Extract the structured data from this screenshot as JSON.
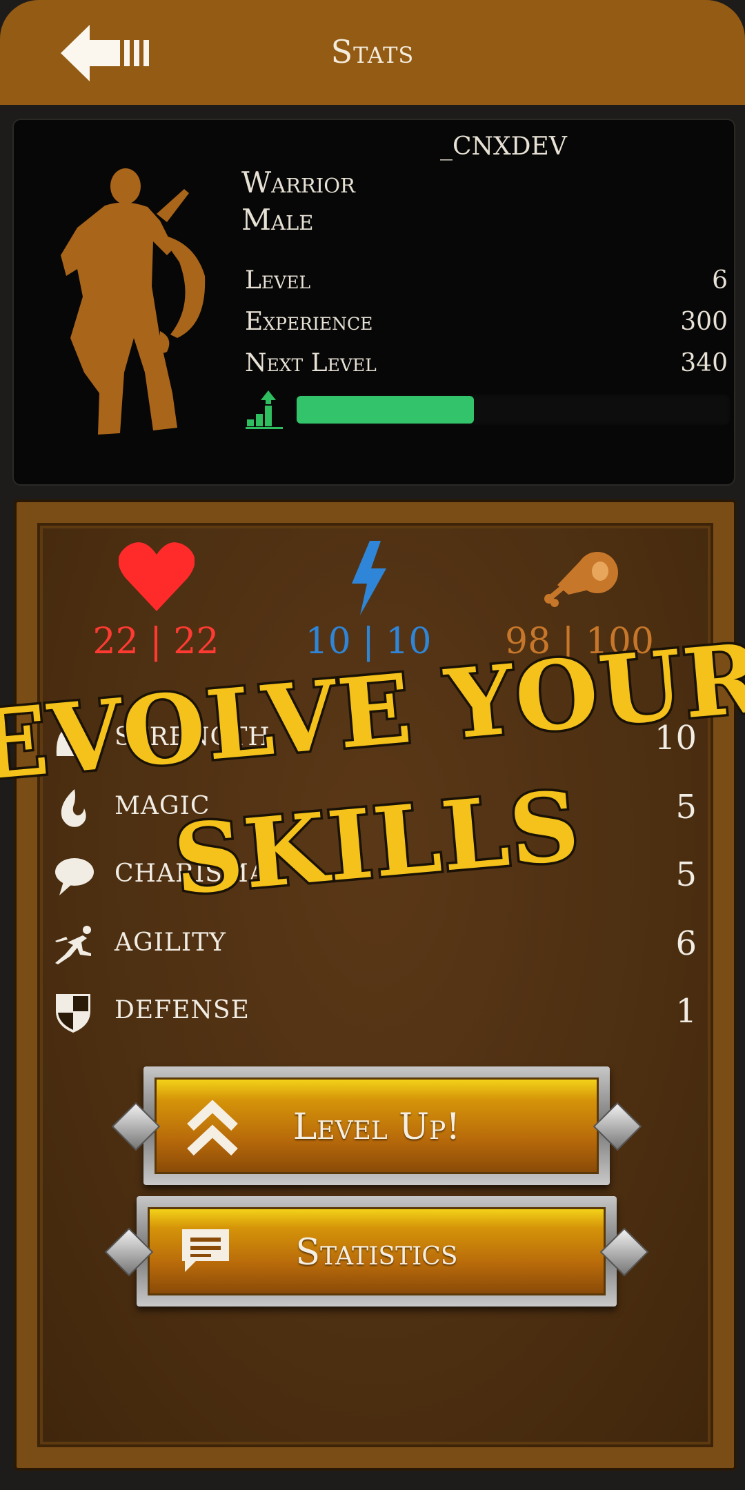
{
  "header": {
    "title": "Stats",
    "back_icon": "back-arrow-icon"
  },
  "character": {
    "username": "_CNXDEV",
    "class": "Warrior",
    "gender": "Male",
    "stats": [
      {
        "label": "Level",
        "value": "6"
      },
      {
        "label": "Experience",
        "value": "300"
      },
      {
        "label": "Next Level",
        "value": "340"
      }
    ],
    "xp_progress": 0.41
  },
  "resources": {
    "health": {
      "value": "22 | 22",
      "color": "#ff3a32",
      "icon": "heart-icon"
    },
    "energy": {
      "value": "10 | 10",
      "color": "#2f86d8",
      "icon": "lightning-icon"
    },
    "food": {
      "value": "98 | 100",
      "color": "#c7772a",
      "icon": "meat-icon"
    }
  },
  "attributes": [
    {
      "name": "Strength",
      "value": "10",
      "icon": "strength-icon"
    },
    {
      "name": "Magic",
      "value": "5",
      "icon": "flame-icon"
    },
    {
      "name": "Charisma",
      "value": "5",
      "icon": "speech-bubble-icon"
    },
    {
      "name": "Agility",
      "value": "6",
      "icon": "running-figure-icon"
    },
    {
      "name": "Defense",
      "value": "1",
      "icon": "shield-icon"
    }
  ],
  "buttons": {
    "level_up": "Level Up!",
    "statistics": "Statistics"
  },
  "promo": {
    "line1": "EVOLVE YOUR",
    "line2": "SKILLS",
    "color": "#f4c21a"
  }
}
